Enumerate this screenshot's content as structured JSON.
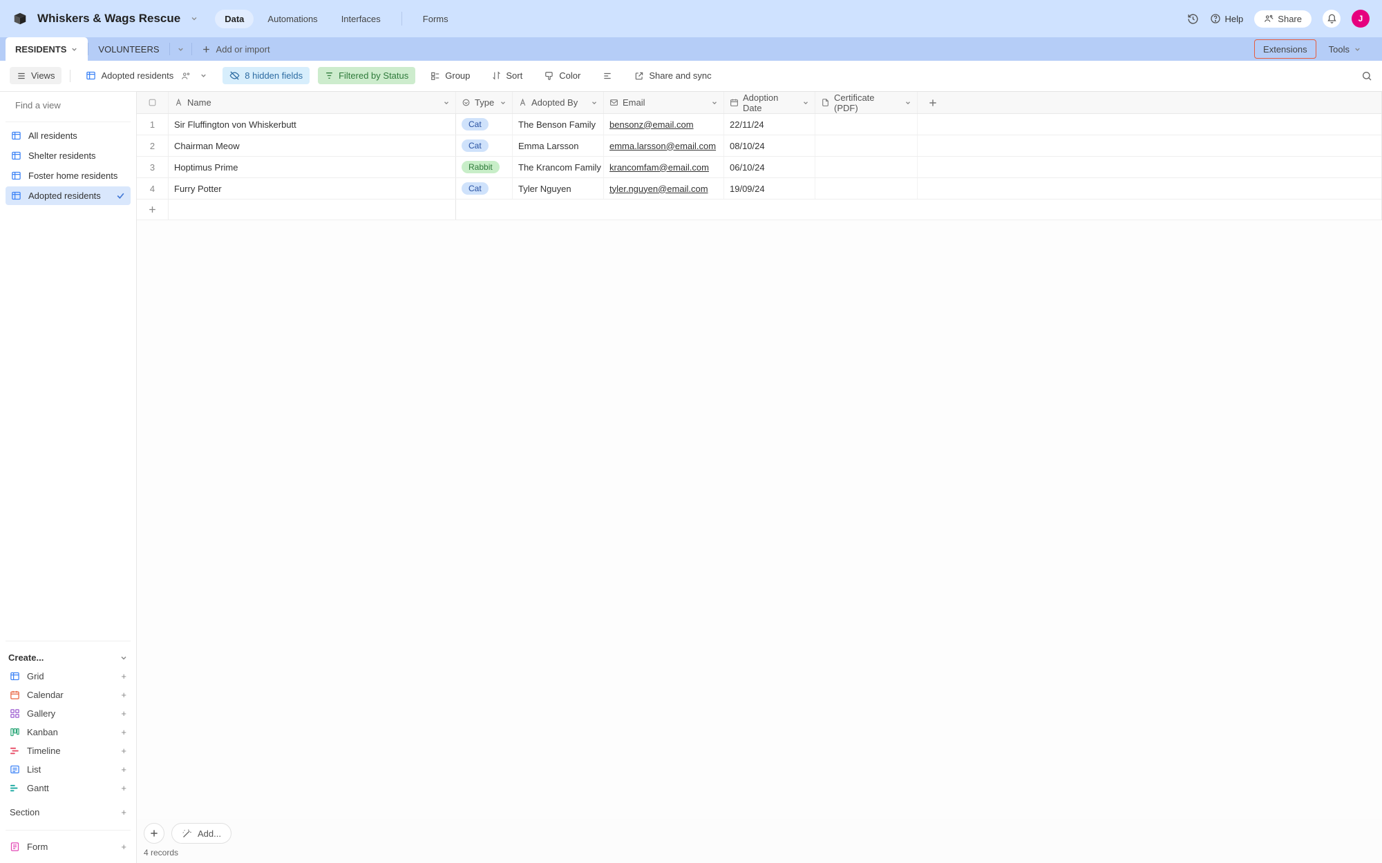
{
  "header": {
    "workspace_title": "Whiskers & Wags Rescue",
    "nav": {
      "data": "Data",
      "automations": "Automations",
      "interfaces": "Interfaces",
      "forms": "Forms"
    },
    "help": "Help",
    "share": "Share",
    "avatar_initial": "J"
  },
  "tablesbar": {
    "tab_residents": "RESIDENTS",
    "tab_volunteers": "VOLUNTEERS",
    "add_or_import": "Add or import",
    "extensions": "Extensions",
    "tools": "Tools"
  },
  "toolbar": {
    "views": "Views",
    "current_view": "Adopted residents",
    "hidden_fields": "8 hidden fields",
    "filtered": "Filtered by Status",
    "group": "Group",
    "sort": "Sort",
    "color": "Color",
    "share_sync": "Share and sync"
  },
  "sidebar": {
    "search_placeholder": "Find a view",
    "views": {
      "all": "All residents",
      "shelter": "Shelter residents",
      "foster": "Foster home residents",
      "adopted": "Adopted residents"
    },
    "create_header": "Create...",
    "create": {
      "grid": "Grid",
      "calendar": "Calendar",
      "gallery": "Gallery",
      "kanban": "Kanban",
      "timeline": "Timeline",
      "list": "List",
      "gantt": "Gantt"
    },
    "section": "Section",
    "form": "Form"
  },
  "grid": {
    "columns": {
      "name": "Name",
      "type": "Type",
      "adopted_by": "Adopted By",
      "email": "Email",
      "adoption_date": "Adoption Date",
      "certificate": "Certificate (PDF)"
    },
    "rows": [
      {
        "num": "1",
        "name": "Sir Fluffington von Whiskerbutt",
        "type": "Cat",
        "type_class": "cat",
        "adopted_by": "The Benson Family",
        "email": "bensonz@email.com",
        "adoption_date": "22/11/24"
      },
      {
        "num": "2",
        "name": "Chairman Meow",
        "type": "Cat",
        "type_class": "cat",
        "adopted_by": "Emma Larsson",
        "email": "emma.larsson@email.com",
        "adoption_date": "08/10/24"
      },
      {
        "num": "3",
        "name": "Hoptimus Prime",
        "type": "Rabbit",
        "type_class": "rabbit",
        "adopted_by": "The Krancom Family",
        "email": "krancomfam@email.com",
        "adoption_date": "06/10/24"
      },
      {
        "num": "4",
        "name": "Furry Potter",
        "type": "Cat",
        "type_class": "cat",
        "adopted_by": "Tyler Nguyen",
        "email": "tyler.nguyen@email.com",
        "adoption_date": "19/09/24"
      }
    ],
    "record_count": "4 records",
    "add_magic": "Add..."
  }
}
